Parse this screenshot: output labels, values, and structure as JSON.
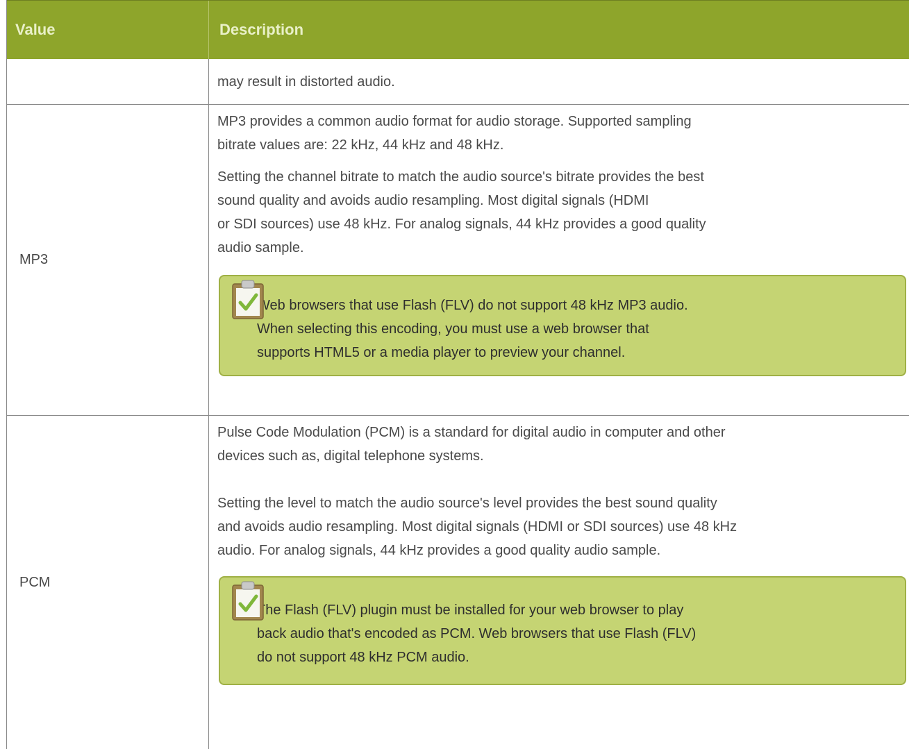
{
  "header": {
    "value": "Value",
    "description": "Description"
  },
  "rows": [
    {
      "value": "",
      "description": [
        "may result in distorted audio."
      ]
    },
    {
      "value": "MP3",
      "paragraphs": [
        [
          "MP3 provides a common audio format for audio storage. Supported sampling",
          "bitrate values are: 22 kHz, 44 kHz and 48 kHz."
        ],
        [
          "Setting the channel bitrate to match the audio source's bitrate provides the best",
          "sound quality and avoids audio resampling. Most digital signals (HDMI",
          "or SDI sources) use 48 kHz. For analog signals, 44 kHz provides a good quality",
          "audio sample."
        ]
      ],
      "note": [
        "Web browsers that use Flash (FLV) do not support 48 kHz MP3 audio.",
        "When selecting this encoding, you must use a web browser that",
        "supports HTML5 or a media player to preview your channel."
      ],
      "note_icon": "clipboard-check-icon"
    },
    {
      "value": "PCM",
      "paragraphs": [
        [
          "Pulse Code Modulation (PCM) is a standard for digital audio in computer and other",
          "devices such as, digital telephone systems."
        ],
        [
          "Setting the level to match the audio source's level provides the best sound quality",
          "and avoids audio resampling. Most digital signals (HDMI or SDI sources) use 48 kHz",
          "audio. For analog signals, 44 kHz provides a good quality audio sample."
        ]
      ],
      "note": [
        "The Flash (FLV) plugin must be installed for your web browser to play",
        "back audio that's encoded as PCM. Web browsers that use Flash (FLV)",
        "do not support 48 kHz PCM audio."
      ],
      "note_icon": "clipboard-check-icon"
    }
  ],
  "colors": {
    "header_bg": "#8ea52b",
    "header_text": "#e9f0c8",
    "note_bg": "#c5d473",
    "note_border": "#9fb045"
  }
}
